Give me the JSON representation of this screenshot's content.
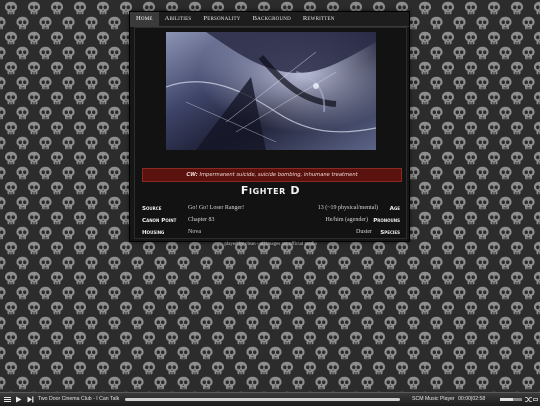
{
  "nav": {
    "tabs": [
      {
        "label": "Home",
        "active": true
      },
      {
        "label": "Abilities",
        "active": false
      },
      {
        "label": "Personality",
        "active": false
      },
      {
        "label": "Background",
        "active": false
      },
      {
        "label": "Rewritten",
        "active": false
      }
    ]
  },
  "profile": {
    "content_warning_label": "CW:",
    "content_warning_text": "Impermanent suicide, suicide bombing, inhumane treatment",
    "name": "Fighter D",
    "rows": [
      {
        "label": "Source",
        "value": "Go! Go! Loser Ranger!",
        "right_value": "13 (~19 physical/mental)",
        "right_label": "Age"
      },
      {
        "label": "Canon Point",
        "value": "Chapter 83",
        "right_value": "He/him (agender)",
        "right_label": "Pronouns"
      },
      {
        "label": "Housing",
        "value": "Nova",
        "right_value": "Duster",
        "right_label": "Species"
      }
    ],
    "credit": "played by clean - all images are official media"
  },
  "background": {
    "pattern": "skull-icon",
    "base_color": "#2c2c2c",
    "skull_color": "#8e8e8e"
  },
  "player": {
    "track_title": "Two Door Cinema Club - I Can Talk",
    "brand": "SCM Music Player",
    "time": "00:00|02:58",
    "progress": 0.0,
    "volume": 0.6,
    "icons": [
      "menu-icon",
      "play-icon",
      "next-icon",
      "shuffle-icon",
      "repeat-icon"
    ]
  },
  "colors": {
    "accent_red": "#5a120f",
    "card_bg": "#161616"
  }
}
